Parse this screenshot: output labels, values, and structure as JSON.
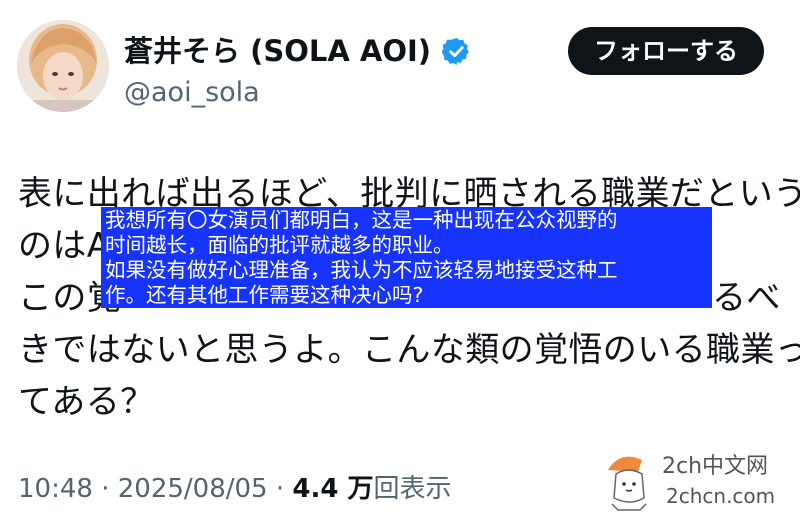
{
  "author": {
    "display_name": "蒼井そら (SOLA AOI)",
    "handle": "@aoi_sola",
    "verified": true,
    "avatar": "profile-photo"
  },
  "follow_button": {
    "label": "フォローする"
  },
  "tweet": {
    "lines": [
      "表に出れば出るほど、批判に晒される職業だという",
      "のはA",
      "この覚",
      "きではないと思うよ。こんな類の覚悟のいる職業っ",
      "てある？"
    ],
    "line3_tail": "るべ"
  },
  "translation_overlay": {
    "lines": [
      "我想所有〇女演员们都明白，这是一种出现在公众视野的",
      "时间越长，面临的批评就越多的职业。",
      "如果没有做好心理准备，我认为不应该轻易地接受这种工",
      "作。还有其他工作需要这种决心吗?"
    ],
    "background_color": "#1734ff"
  },
  "meta": {
    "time": "10:48",
    "separator": " · ",
    "date": "2025/08/05",
    "views_count": "4.4 万",
    "views_label": "回表示"
  },
  "watermark": {
    "site_name": "2ch中文网",
    "site_url": "2chcn.com"
  },
  "colors": {
    "text_primary": "#0f1419",
    "text_secondary": "#536471",
    "verified_blue": "#1d9bf0",
    "follow_bg": "#0f1419"
  }
}
